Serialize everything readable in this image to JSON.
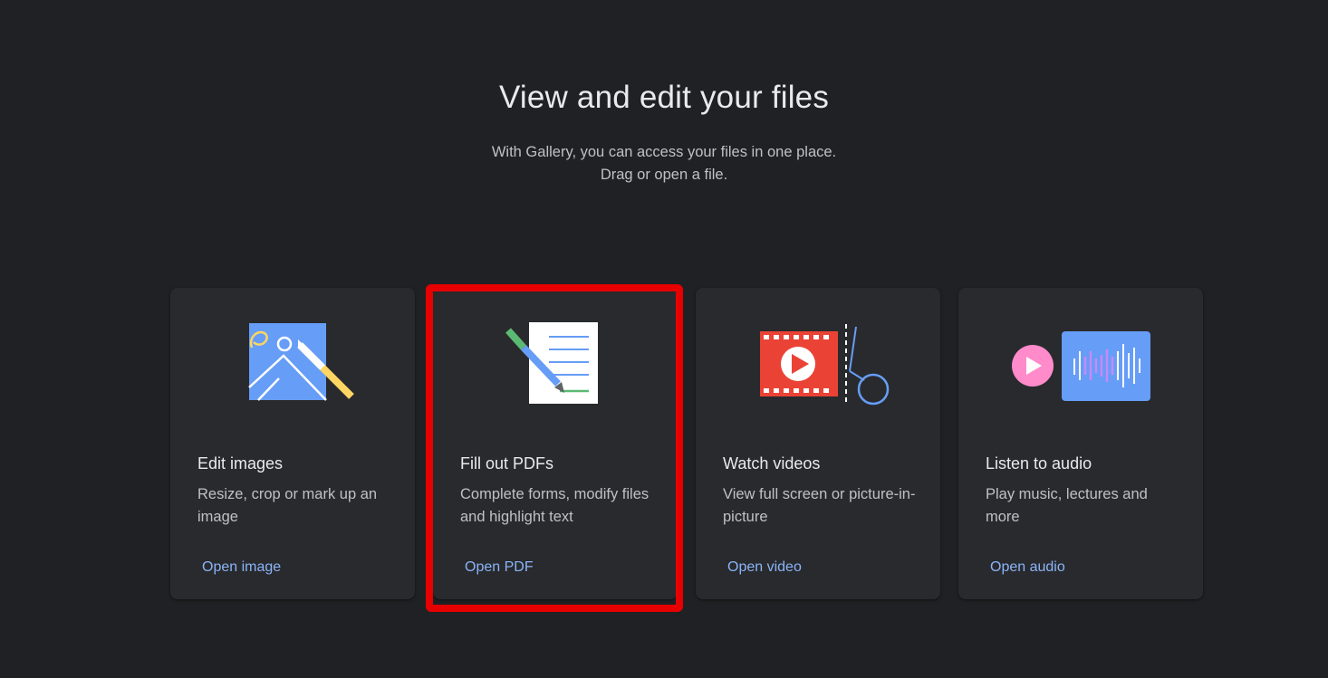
{
  "header": {
    "title": "View and edit your files",
    "subtitle_line1": "With Gallery, you can access your files in one place.",
    "subtitle_line2": "Drag or open a file."
  },
  "cards": [
    {
      "title": "Edit images",
      "description": "Resize, crop or mark up an image",
      "link": "Open image",
      "icon": "edit-image-illustration"
    },
    {
      "title": "Fill out PDFs",
      "description": "Complete forms, modify files and highlight text",
      "link": "Open PDF",
      "icon": "pdf-document-illustration",
      "highlighted": true
    },
    {
      "title": "Watch videos",
      "description": "View full screen or picture-in-picture",
      "link": "Open video",
      "icon": "video-film-illustration"
    },
    {
      "title": "Listen to audio",
      "description": "Play music, lectures and more",
      "link": "Open audio",
      "icon": "audio-waveform-illustration"
    }
  ],
  "colors": {
    "background": "#202124",
    "card": "#292a2d",
    "link": "#8ab4f8",
    "highlight": "#e60000",
    "blue": "#669df6",
    "yellow": "#fdd663",
    "green": "#5bb974",
    "red": "#ea4335",
    "pink": "#ff8bcb"
  }
}
